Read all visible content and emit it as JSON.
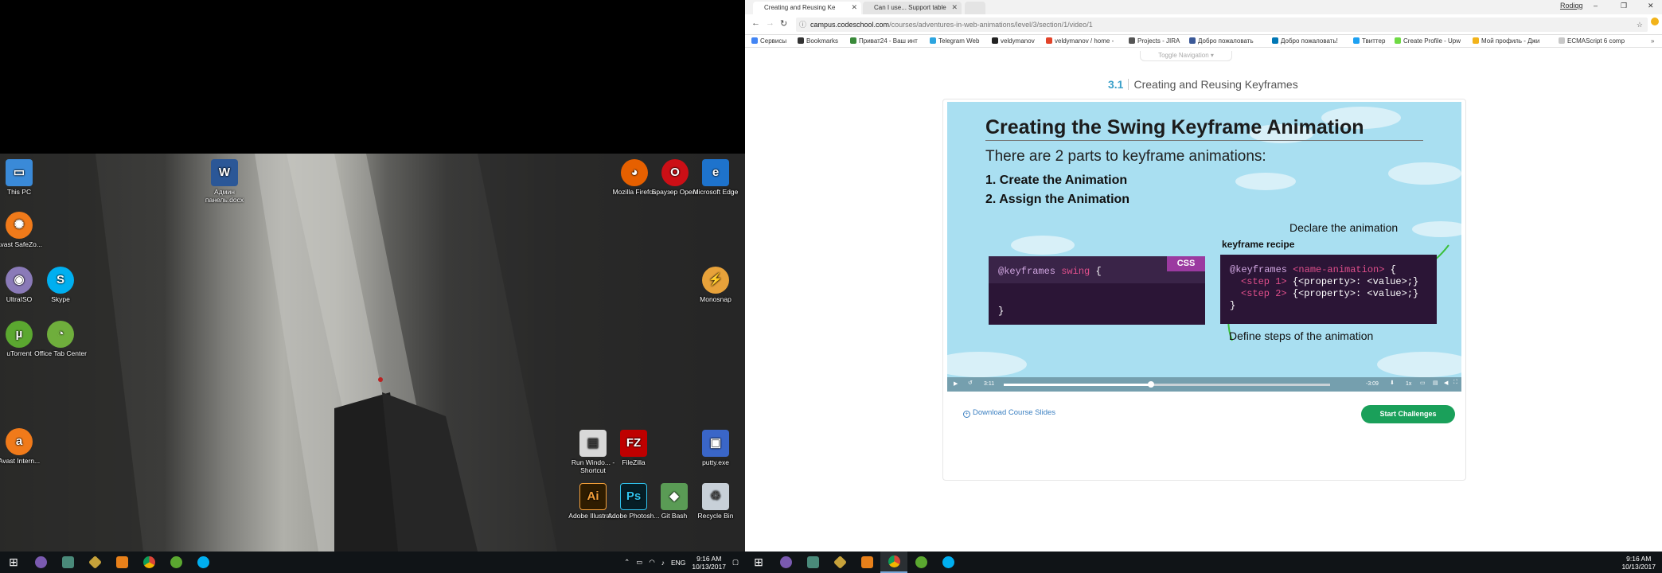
{
  "desktop": {
    "icons": [
      {
        "label": "This PC",
        "icon": "computer-icon",
        "color": "#3a8ad8"
      },
      {
        "label": "Avast SafeZo...",
        "icon": "avast-safezone-icon",
        "color": "#f07a1a"
      },
      {
        "label": "UltraISO",
        "icon": "disc-icon",
        "color": "#8a7ab8"
      },
      {
        "label": "Skype",
        "icon": "skype-icon",
        "color": "#00aff0"
      },
      {
        "label": "uTorrent",
        "icon": "utorrent-icon",
        "color": "#5ba830"
      },
      {
        "label": "Office Tab Center",
        "icon": "office-tab-icon",
        "color": "#6fae3c"
      },
      {
        "label": "Avast Intern...",
        "icon": "avast-icon",
        "color": "#f07a1a"
      },
      {
        "label": "Админ панель.docx",
        "icon": "word-doc-icon",
        "color": "#2b5797"
      },
      {
        "label": "Mozilla Firefox",
        "icon": "firefox-icon",
        "color": "#e66000"
      },
      {
        "label": "Браузер Opera",
        "icon": "opera-icon",
        "color": "#cc0f16"
      },
      {
        "label": "Microsoft Edge",
        "icon": "edge-icon",
        "color": "#1e73cc"
      },
      {
        "label": "Monosnap",
        "icon": "monosnap-icon",
        "color": "#e8a23a"
      },
      {
        "label": "Run Windo... - Shortcut",
        "icon": "run-icon",
        "color": "#d8d8d8"
      },
      {
        "label": "FileZilla",
        "icon": "filezilla-icon",
        "color": "#bf0000"
      },
      {
        "label": "putty.exe",
        "icon": "putty-icon",
        "color": "#3a66c8"
      },
      {
        "label": "Adobe Illustrat...",
        "icon": "illustrator-icon",
        "color": "#2e1c00"
      },
      {
        "label": "Adobe Photosh...",
        "icon": "photoshop-icon",
        "color": "#061e26"
      },
      {
        "label": "Git Bash",
        "icon": "git-bash-icon",
        "color": "#5a9b55"
      },
      {
        "label": "Recycle Bin",
        "icon": "recycle-bin-icon",
        "color": "#c8d0d8"
      }
    ],
    "ai_text": "Ai",
    "ps_text": "Ps",
    "fz_text": "FZ"
  },
  "taskbar_left": {
    "clock_time": "9:16 AM",
    "clock_date": "10/13/2017",
    "lang": "ENG"
  },
  "taskbar_right": {
    "clock_time": "9:16 AM",
    "clock_date": "10/13/2017"
  },
  "browser": {
    "tabs": [
      {
        "label": "Creating and Reusing Ke",
        "active": true
      },
      {
        "label": "Can I use... Support table",
        "active": false
      }
    ],
    "profile_name": "Rodiqg",
    "url_host": "campus.codeschool.com",
    "url_path": "/courses/adventures-in-web-animations/level/3/section/1/video/1",
    "bookmarks": [
      "Сервисы",
      "Bookmarks",
      "Приват24 - Ваш инт",
      "Telegram Web",
      "veldymanov",
      "veldymanov / home -",
      "Projects - JIRA",
      "Добро пожаловать",
      "Добро пожаловать!",
      "Твиттер",
      "Create Profile - Upw",
      "Мой профиль - Джи",
      "ECMAScript 6 comp"
    ]
  },
  "page": {
    "toggle_nav": "Toggle Navigation",
    "lesson_number": "3.1",
    "lesson_title": "Creating and Reusing Keyframes",
    "download_label": "Download Course Slides",
    "start_label": "Start Challenges"
  },
  "video": {
    "title": "Creating the Swing Keyframe Animation",
    "subtitle": "There are 2 parts to keyframe animations:",
    "step1": "1.  Create the Animation",
    "step2": "2.  Assign the Animation",
    "declare_note": "Declare the animation",
    "recipe_label": "keyframe recipe",
    "define_note": "Define steps of the animation",
    "css_tag": "CSS",
    "css_code_kw": "@keyframes",
    "css_code_name": "swing",
    "css_code_open": "{",
    "css_code_close": "}",
    "recipe_kw": "@keyframes",
    "recipe_name": "<name-animation>",
    "recipe_open": "{",
    "recipe_step1": "<step 1>",
    "recipe_step2": "<step 2>",
    "recipe_prop": "{<property>: <value>;}",
    "recipe_close": "}",
    "time_current": "3:11",
    "time_remaining": "-3:09",
    "speed": "1x",
    "progress_fraction": 0.45
  }
}
